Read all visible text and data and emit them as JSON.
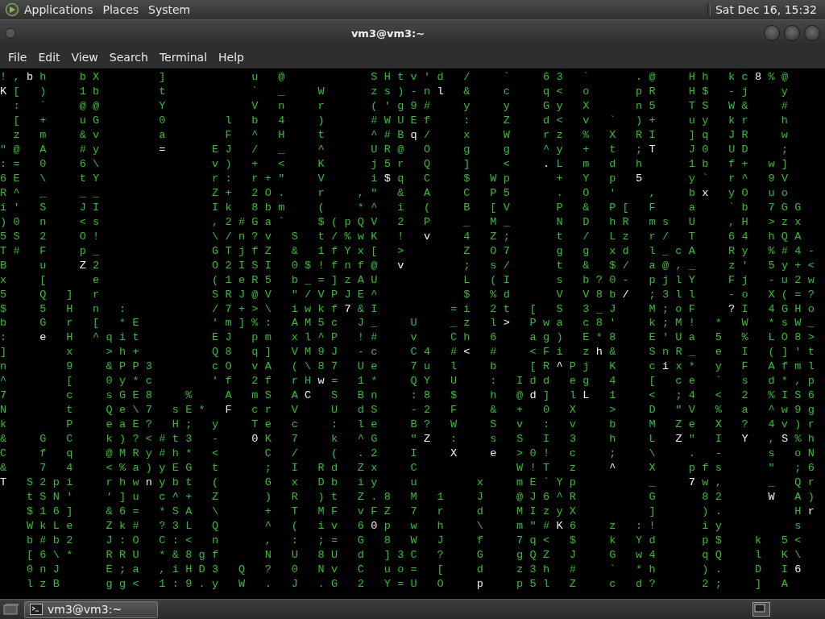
{
  "top_panel": {
    "menus": [
      "Applications",
      "Places",
      "System"
    ],
    "clock": "Sat Dec 16, 15:32"
  },
  "window": {
    "title": "vm3@vm3:~",
    "menu": [
      "File",
      "Edit",
      "View",
      "Search",
      "Terminal",
      "Help"
    ],
    "terminal": {
      "rows": [
        {
          "runs": [
            {
              "text": "!,",
              "head": false
            },
            {
              "text": "b",
              "head": true
            },
            {
              "text": "h  bX    ]      u @      SHtv'd /  `  63 `   .@  Hh kc",
              "head": false
            },
            {
              "text": "8",
              "head": true
            },
            {
              "text": "%@",
              "head": false
            }
          ]
        },
        {
          "runs": [
            {
              "text": "K",
              "head": true
            },
            {
              "text": "[ )  1b    t      ` _  W   zs)-n",
              "head": false
            },
            {
              "text": "l",
              "head": true
            },
            {
              "text": " &  c  q< o   pR  H$ -j  y",
              "head": false
            }
          ]
        },
        {
          "runs": [
            {
              "text": " : `  @@    Y      V n  r   ('g9#  y  y  Gy X   n5  TS W&  #",
              "head": false
            }
          ]
        },
        {
          "runs": [
            {
              "text": " [ +  uG    0    l b 4  )   #WUEf  :  Z  d< v ` )+  uy kr  h",
              "head": false
            }
          ]
        },
        {
          "runs": [
            {
              "text": " z m  &v    a    F ^ H  t   ^#B",
              "head": false
            },
            {
              "text": "q",
              "head": true
            },
            {
              "text": "/  x  W  rz % X RI  ]q JR  w",
              "head": false
            }
          ]
        },
        {
          "runs": [
            {
              "text": "\"@ A  #y    ",
              "head": false
            },
            {
              "text": "=",
              "head": true
            },
            {
              "text": "   EJ / _  ^   UR@ O  g  g  ^y + t ;",
              "head": false
            },
            {
              "text": "T",
              "head": true
            },
            {
              "text": "  J0 UD  ;",
              "head": false
            }
          ]
        },
        {
          "runs": [
            {
              "text": ":= 0  6\\        v) + <  K   j5r Q  ]  <  ",
              "head": false
            },
            {
              "text": ".",
              "head": true
            },
            {
              "text": "L m d h   1b f+ w]",
              "head": false
            }
          ]
        },
        {
          "runs": [
            {
              "text": "6E \\  tY        r: r+\"  V   i",
              "head": false
            },
            {
              "text": "$",
              "head": true
            },
            {
              "text": "q C  $ Wp   + Y p ",
              "head": false
            },
            {
              "text": "5",
              "head": true
            },
            {
              "text": "   y` r^ 9V",
              "head": false
            }
          ]
        },
        {
          "runs": [
            {
              "text": "R^ _  __        Z+ 2O.  r  ,\" & A  C P5   . O '  ,  b",
              "head": false
            },
            {
              "text": "x",
              "head": true
            },
            {
              "text": " yO uo",
              "head": false
            }
          ]
        },
        {
          "runs": [
            {
              "text": "i' S  JI        Ik 8bm  (  *^ i (  B [V   P & P[ F  a  `b 7GG",
              "head": false
            }
          ]
        },
        {
          "runs": [
            {
              "text": ")0 n  <s        ,2#Ga`  $(pQV 2 P  _ M_   N D hR ms U  ,H >zx",
              "head": false
            }
          ]
        },
        {
          "runs": [
            {
              "text": "5S 2  O!        \\/n?v S t/%wK ! ",
              "head": false
            },
            {
              "text": "v",
              "head": true
            },
            {
              "text": "  4 Z;   t / Lz r/ T  64 hQA",
              "head": false
            }
          ]
        },
        {
          "runs": [
            {
              "text": "T# F  p_        GTjfZ & 1fYx[ >    Z O7   g g xd l_cA  Ry %#4-",
              "head": false
            }
          ]
        },
        {
          "runs": [
            {
              "text": "B  u  ",
              "head": false
            },
            {
              "text": "Z",
              "head": true
            },
            {
              "text": "2        O2ISI 0$!fnf@ ",
              "head": false
            },
            {
              "text": "v",
              "head": true
            },
            {
              "text": "    ; s/   t & $/ a@,_  z' 5y+<",
              "head": false
            }
          ]
        },
        {
          "runs": [
            {
              "text": "x  [   e        (1eR5 b_=]zAU      L (I   s b?0- pjlY  Fj -u2w",
              "head": false
            }
          ]
        },
        {
          "runs": [
            {
              "text": "5  Q ] r        SRJ@V \"/VPJE^      $ %d   V V8b",
              "head": false
            },
            {
              "text": "/",
              "head": true
            },
            {
              "text": " ;3ll  -o X(=?",
              "head": false
            }
          ]
        },
        {
          "runs": [
            {
              "text": "$  5 H n :      /7+>\\ iwkf",
              "head": false
            },
            {
              "text": "7",
              "head": true
            },
            {
              "text": "&I     =i 2t [ S 3_J  M;oF  ",
              "head": false
            },
            {
              "text": "?",
              "head": true
            },
            {
              "text": "I 4GHo",
              "head": false
            }
          ]
        },
        {
          "runs": [
            {
              "text": "b  G r [ *E     'm]%: AM5c J_  U  _z l",
              "head": false
            },
            {
              "text": ">",
              "head": true
            },
            {
              "text": " Pwa c8'  k;M! * W *sW_",
              "head": false
            }
          ]
        },
        {
          "runs": [
            {
              "text": ":  ",
              "head": false
            },
            {
              "text": "e",
              "head": true
            },
            {
              "text": " H ^qit     EJ pm xl^P !#  v  Ch 6  ag) E*8  E'Ua 5 % LO8>",
              "head": false
            }
          ]
        },
        {
          "runs": [
            {
              "text": "]    x  >h+     Q8 q] VM9J -c  C4 #",
              "head": false
            },
            {
              "text": "<",
              "head": true
            },
            {
              "text": " #  <Fi z",
              "head": false
            },
            {
              "text": "h",
              "head": true
            },
            {
              "text": "&  SnR_ e I (]'t",
              "head": false
            }
          ]
        },
        {
          "runs": [
            {
              "text": "n    9  &PP3    cO vA (\\87 Ue  7u l  b  [R",
              "head": false
            },
            {
              "text": "^",
              "head": true
            },
            {
              "text": "Pj K  c",
              "head": false
            },
            {
              "text": "i",
              "head": true
            },
            {
              "text": "x* y F Afml",
              "head": false
            }
          ]
        },
        {
          "runs": [
            {
              "text": "^    [  0y*c    'f 2f rH",
              "head": false
            },
            {
              "text": "w",
              "head": true
            },
            {
              "text": "= 1*  QY U  : Idd eg 4  [ ce ` s d*,p",
              "head": false
            }
          ]
        },
        {
          "runs": [
            {
              "text": "7    c  sGE8  %  A mS A",
              "head": false
            },
            {
              "text": "C",
              "head": true
            },
            {
              "text": " S Bn  :8 $  h @",
              "head": false
            },
            {
              "text": "d",
              "head": true
            },
            {
              "text": "] l",
              "head": false
            },
            {
              "text": "L",
              "head": true
            },
            {
              "text": " 1  < ;4 < 2 %IS6",
              "head": false
            }
          ]
        },
        {
          "runs": [
            {
              "text": "N    t  Qe\\7 sE* ",
              "head": false
            },
            {
              "text": "F",
              "head": true
            },
            {
              "text": " cr V  U dS  -2 F  & + 0 X  >  D \"V % a ^w9g",
              "head": false
            }
          ]
        },
        {
          "runs": [
            {
              "text": "k    P  eaE? H; y  Te c  : le  B? W  S v : v  b  M Ze X ? 4v)r",
              "head": false
            }
          ]
        },
        {
          "runs": [
            {
              "text": "&  G C  k)?<#t3 -  ",
              "head": false
            },
            {
              "text": "0",
              "head": true
            },
            {
              "text": "K 7  k ^G  \"",
              "head": false
            },
            {
              "text": "Z",
              "head": true
            },
            {
              "text": " :  s S I 3  h  L ",
              "head": false
            },
            {
              "text": "Z",
              "head": true
            },
            {
              "text": "\" I ",
              "head": false
            },
            {
              "text": "Y",
              "head": true
            },
            {
              "text": " ,",
              "head": false
            },
            {
              "text": "S",
              "head": true
            },
            {
              "text": "%h",
              "head": false
            }
          ]
        },
        {
          "runs": [
            {
              "text": "C  f q  @MRy#h* <   C /  ( .2  I  ",
              "head": false
            },
            {
              "text": "X  ",
              "head": true
            },
            {
              "text": "e",
              "head": true
            },
            {
              "text": " >0! c  ;  \\  . -   s oN",
              "head": false
            }
          ]
        },
        {
          "runs": [
            {
              "text": "&  7 4  <%a)yEG t   ; I Rd Zx  C       W!T z  ",
              "head": false
            },
            {
              "text": "^",
              "head": true
            },
            {
              "text": "  X  pfs   \" ;6",
              "head": false
            }
          ]
        },
        {
          "runs": [
            {
              "text": "T",
              "head": true
            },
            {
              "text": " S2pi  rhw",
              "head": false
            },
            {
              "text": "n",
              "head": true
            },
            {
              "text": "ybt (   G x Db iy  u    x  mE`Yp     _  ",
              "head": false
            },
            {
              "text": "7",
              "head": true
            },
            {
              "text": "w,   _ Qr",
              "head": false
            }
          ]
        },
        {
          "runs": [
            {
              "text": "  tSN'  ']u c^+ Z   ) R )t Z.8 M 1  J  @J6^R     G   82   ",
              "head": false
            },
            {
              "text": "W",
              "head": true
            },
            {
              "text": " A)",
              "head": false
            }
          ]
        },
        {
          "runs": [
            {
              "text": "  $16]  &6= *SA \\   + T MF vFZ 7 r  d  MIzyX     ]   ).     H",
              "head": false
            },
            {
              "text": "r",
              "head": true
            }
          ]
        },
        {
          "runs": [
            {
              "text": "  WkLe  Zk# ?3L Q   ^ ( iv 6",
              "head": false
            },
            {
              "text": "0",
              "head": true
            },
            {
              "text": "p w h  \\  m\"#",
              "head": false
            },
            {
              "text": "K",
              "head": true
            },
            {
              "text": "6  z :!   iy     s",
              "head": false
            }
          ]
        },
        {
          "runs": [
            {
              "text": "  b#b2  J:O C:< n   , : ;= G 8 W J  f  7q< $  k Yd   p$  k 5<",
              "head": false
            }
          ]
        },
        {
          "runs": [
            {
              "text": "  [6\\*  RRU *&8gf   N U 8U d ]3C ?  G  gQZ J  G w4   qQ  l K\\",
              "head": false
            }
          ]
        },
        {
          "runs": [
            {
              "text": "  0nJ   E;a ,iHD3 Q ? 0 Nv C uo= [  d  z3h #  ` *h   ).  D I",
              "head": false
            },
            {
              "text": "6",
              "head": true
            }
          ]
        },
        {
          "runs": [
            {
              "text": "  lzB   gg< 1:9.y W . J .G 2 Y=U O  ",
              "head": false
            },
            {
              "text": "p",
              "head": true
            },
            {
              "text": "  p5l Z  c d?   2;  ] A",
              "head": false
            }
          ]
        }
      ]
    }
  },
  "taskbar": {
    "tasks": [
      {
        "label": "vm3@vm3:~",
        "selected": true
      }
    ]
  }
}
